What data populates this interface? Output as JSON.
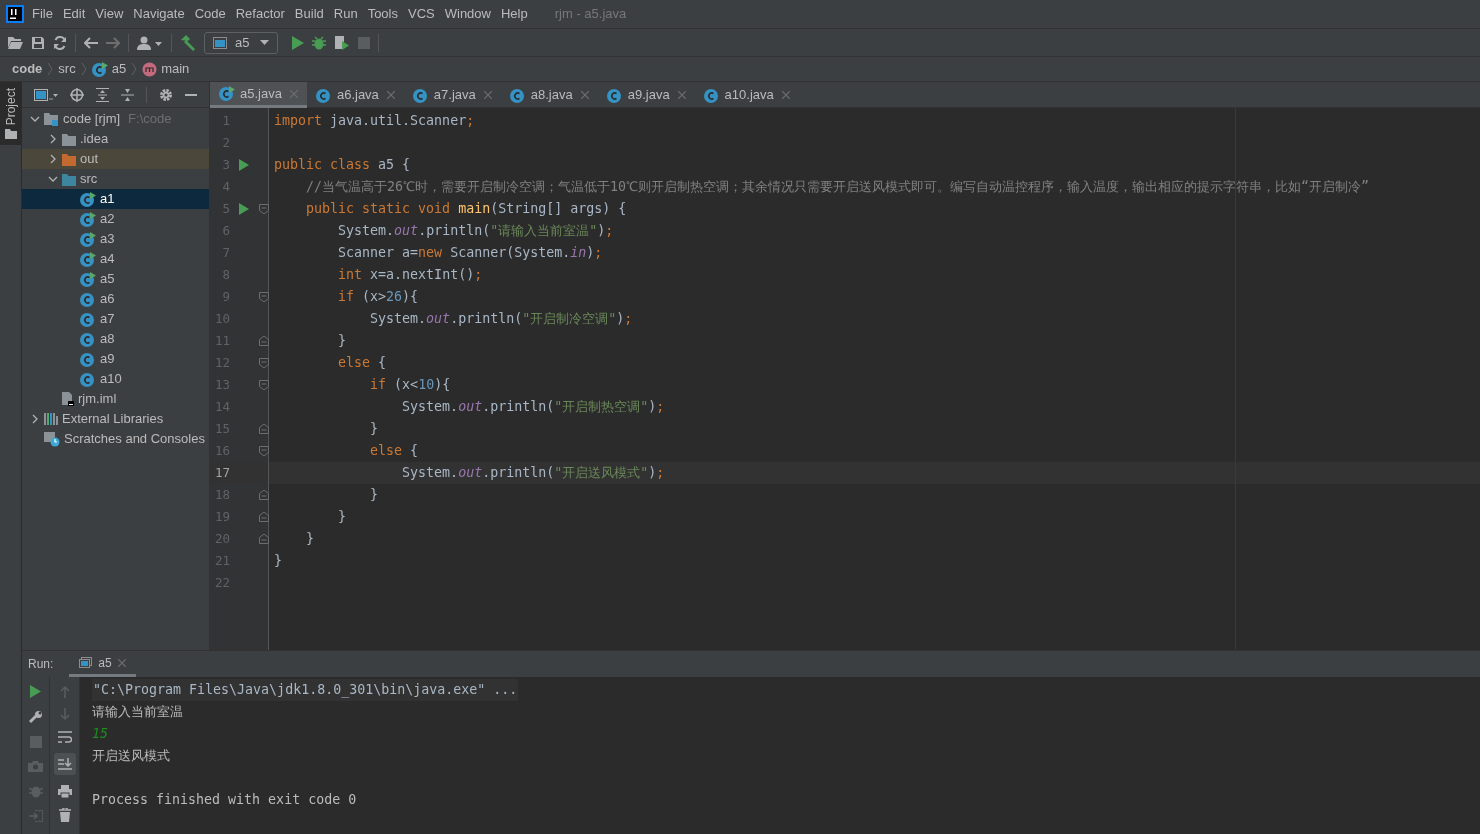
{
  "window": {
    "title": "rjm - a5.java"
  },
  "menu": [
    "File",
    "Edit",
    "View",
    "Navigate",
    "Code",
    "Refactor",
    "Build",
    "Run",
    "Tools",
    "VCS",
    "Window",
    "Help"
  ],
  "toolbar": {
    "run_config": "a5"
  },
  "breadcrumbs": [
    {
      "label": "code",
      "kind": "project"
    },
    {
      "label": "src",
      "kind": "folder"
    },
    {
      "label": "a5",
      "kind": "class"
    },
    {
      "label": "main",
      "kind": "method"
    }
  ],
  "side_tab": {
    "label": "Project",
    "selected": true
  },
  "project_tree": [
    {
      "label": "code [rjm]",
      "path": "F:\\code",
      "kind": "module",
      "expanded": true,
      "selected": false,
      "children": [
        {
          "label": ".idea",
          "kind": "folder",
          "expanded": false,
          "selected": false
        },
        {
          "label": "out",
          "kind": "excluded",
          "expanded": false,
          "selected": false
        },
        {
          "label": "src",
          "kind": "source",
          "expanded": true,
          "selected": false,
          "children": [
            {
              "label": "a1",
              "kind": "runnable",
              "selected": true
            },
            {
              "label": "a2",
              "kind": "runnable",
              "selected": false
            },
            {
              "label": "a3",
              "kind": "runnable",
              "selected": false
            },
            {
              "label": "a4",
              "kind": "runnable",
              "selected": false
            },
            {
              "label": "a5",
              "kind": "runnable",
              "selected": false
            },
            {
              "label": "a6",
              "kind": "class",
              "selected": false
            },
            {
              "label": "a7",
              "kind": "class",
              "selected": false
            },
            {
              "label": "a8",
              "kind": "class",
              "selected": false
            },
            {
              "label": "a9",
              "kind": "class",
              "selected": false
            },
            {
              "label": "a10",
              "kind": "class",
              "selected": false
            }
          ]
        },
        {
          "label": "rjm.iml",
          "kind": "iml",
          "selected": false
        }
      ]
    },
    {
      "label": "External Libraries",
      "kind": "libraries",
      "expanded": false,
      "selected": false
    },
    {
      "label": "Scratches and Consoles",
      "kind": "scratches",
      "selected": false
    }
  ],
  "tabs": [
    {
      "label": "a5.java",
      "kind": "runnable",
      "selected": true
    },
    {
      "label": "a6.java",
      "kind": "class",
      "selected": false
    },
    {
      "label": "a7.java",
      "kind": "class",
      "selected": false
    },
    {
      "label": "a8.java",
      "kind": "class",
      "selected": false
    },
    {
      "label": "a9.java",
      "kind": "class",
      "selected": false
    },
    {
      "label": "a10.java",
      "kind": "class",
      "selected": false
    }
  ],
  "code": [
    {
      "number": "1",
      "current": false,
      "tokens": [
        {
          "kind": "keyword",
          "text": "import "
        },
        {
          "kind": "plain",
          "text": "java.util.Scanner"
        },
        {
          "kind": "keyword",
          "text": ";"
        }
      ]
    },
    {
      "number": "2",
      "current": false
    },
    {
      "number": "3",
      "current": false,
      "run": true,
      "tokens": [
        {
          "kind": "keyword",
          "text": "public class "
        },
        {
          "kind": "plain",
          "text": "a5 {"
        }
      ]
    },
    {
      "number": "4",
      "current": false,
      "tokens": [
        {
          "kind": "comment",
          "text": "    //当气温高于26℃时，需要开启制冷空调；气温低于10℃则开启制热空调；其余情况只需要开启送风模式即可。编写自动温控程序，输入温度，输出相应的提示字符串，比如“开启制冷”"
        }
      ]
    },
    {
      "number": "5",
      "current": false,
      "run": true,
      "fold_open": true,
      "tokens": [
        {
          "kind": "keyword",
          "text": "    public static void "
        },
        {
          "kind": "method",
          "text": "main"
        },
        {
          "kind": "plain",
          "text": "(String[] args) {"
        }
      ]
    },
    {
      "number": "6",
      "current": false,
      "tokens": [
        {
          "kind": "plain",
          "text": "        System."
        },
        {
          "kind": "field",
          "text": "out"
        },
        {
          "kind": "plain",
          "text": ".println("
        },
        {
          "kind": "string",
          "text": "\"请输入当前室温\""
        },
        {
          "kind": "plain",
          "text": ")"
        },
        {
          "kind": "keyword",
          "text": ";"
        }
      ]
    },
    {
      "number": "7",
      "current": false,
      "tokens": [
        {
          "kind": "plain",
          "text": "        Scanner a="
        },
        {
          "kind": "keyword",
          "text": "new "
        },
        {
          "kind": "plain",
          "text": "Scanner(System."
        },
        {
          "kind": "field",
          "text": "in"
        },
        {
          "kind": "plain",
          "text": ")"
        },
        {
          "kind": "keyword",
          "text": ";"
        }
      ]
    },
    {
      "number": "8",
      "current": false,
      "tokens": [
        {
          "kind": "keyword",
          "text": "        int "
        },
        {
          "kind": "plain",
          "text": "x=a.nextInt()"
        },
        {
          "kind": "keyword",
          "text": ";"
        }
      ]
    },
    {
      "number": "9",
      "current": false,
      "fold_open": true,
      "tokens": [
        {
          "kind": "keyword",
          "text": "        if "
        },
        {
          "kind": "plain",
          "text": "(x>"
        },
        {
          "kind": "number",
          "text": "26"
        },
        {
          "kind": "plain",
          "text": "){"
        }
      ]
    },
    {
      "number": "10",
      "current": false,
      "tokens": [
        {
          "kind": "plain",
          "text": "            System."
        },
        {
          "kind": "field",
          "text": "out"
        },
        {
          "kind": "plain",
          "text": ".println("
        },
        {
          "kind": "string",
          "text": "\"开启制冷空调\""
        },
        {
          "kind": "plain",
          "text": ")"
        },
        {
          "kind": "keyword",
          "text": ";"
        }
      ]
    },
    {
      "number": "11",
      "current": false,
      "fold_close": true,
      "tokens": [
        {
          "kind": "plain",
          "text": "        }"
        }
      ]
    },
    {
      "number": "12",
      "current": false,
      "fold_open": true,
      "tokens": [
        {
          "kind": "keyword",
          "text": "        else "
        },
        {
          "kind": "plain",
          "text": "{"
        }
      ]
    },
    {
      "number": "13",
      "current": false,
      "fold_open": true,
      "tokens": [
        {
          "kind": "keyword",
          "text": "            if "
        },
        {
          "kind": "plain",
          "text": "(x<"
        },
        {
          "kind": "number",
          "text": "10"
        },
        {
          "kind": "plain",
          "text": "){"
        }
      ]
    },
    {
      "number": "14",
      "current": false,
      "tokens": [
        {
          "kind": "plain",
          "text": "                System."
        },
        {
          "kind": "field",
          "text": "out"
        },
        {
          "kind": "plain",
          "text": ".println("
        },
        {
          "kind": "string",
          "text": "\"开启制热空调\""
        },
        {
          "kind": "plain",
          "text": ")"
        },
        {
          "kind": "keyword",
          "text": ";"
        }
      ]
    },
    {
      "number": "15",
      "current": false,
      "fold_close": true,
      "tokens": [
        {
          "kind": "plain",
          "text": "            }"
        }
      ]
    },
    {
      "number": "16",
      "current": false,
      "fold_open": true,
      "tokens": [
        {
          "kind": "keyword",
          "text": "            else "
        },
        {
          "kind": "plain",
          "text": "{"
        }
      ]
    },
    {
      "number": "17",
      "current": true,
      "tokens": [
        {
          "kind": "plain",
          "text": "                System."
        },
        {
          "kind": "field",
          "text": "out"
        },
        {
          "kind": "plain",
          "text": ".println("
        },
        {
          "kind": "string",
          "text": "\"开启送风模式\""
        },
        {
          "kind": "plain",
          "text": ")"
        },
        {
          "kind": "keyword",
          "text": ";"
        }
      ]
    },
    {
      "number": "18",
      "current": false,
      "fold_close": true,
      "tokens": [
        {
          "kind": "plain",
          "text": "            }"
        }
      ]
    },
    {
      "number": "19",
      "current": false,
      "fold_close": true,
      "tokens": [
        {
          "kind": "plain",
          "text": "        }"
        }
      ]
    },
    {
      "number": "20",
      "current": false,
      "fold_close": true,
      "tokens": [
        {
          "kind": "plain",
          "text": "    }"
        }
      ]
    },
    {
      "number": "21",
      "current": false,
      "tokens": [
        {
          "kind": "plain",
          "text": "}"
        }
      ]
    },
    {
      "number": "22",
      "current": false
    }
  ],
  "run_panel": {
    "label": "Run:",
    "tab": {
      "label": "a5",
      "selected": true
    },
    "console": [
      {
        "kind": "command",
        "text": "\"C:\\Program Files\\Java\\jdk1.8.0_301\\bin\\java.exe\" ..."
      },
      {
        "kind": "output",
        "text": "请输入当前室温"
      },
      {
        "kind": "input",
        "text": "15"
      },
      {
        "kind": "output",
        "text": "开启送风模式"
      },
      {
        "kind": "exit",
        "text": "Process finished with exit code 0"
      }
    ]
  }
}
